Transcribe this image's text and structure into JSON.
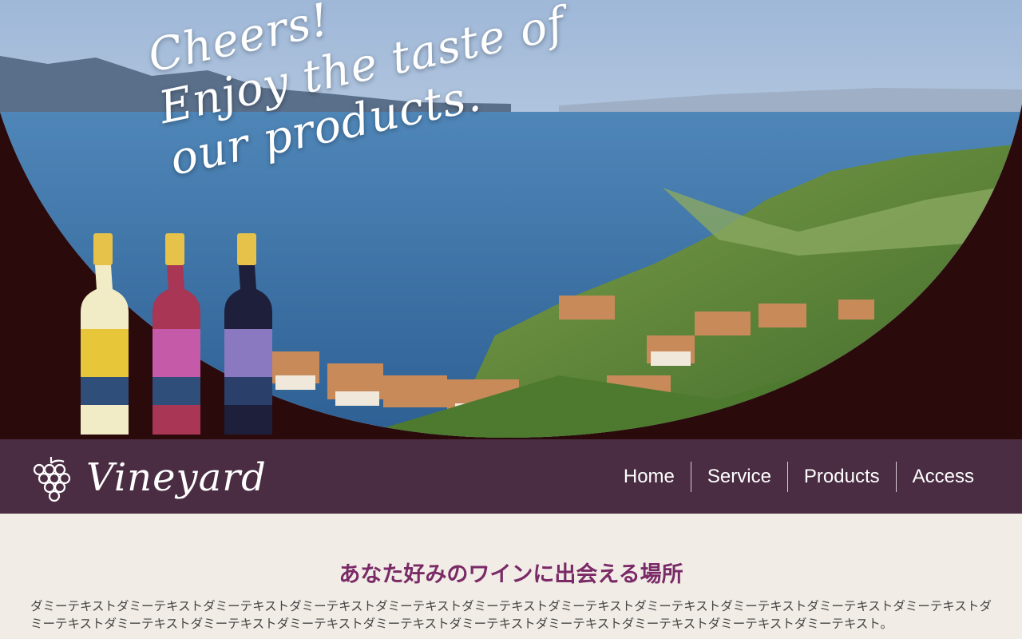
{
  "hero": {
    "tagline_lines": [
      "Cheers!",
      "Enjoy the taste of",
      "our products."
    ]
  },
  "header": {
    "logo_text": "Vineyard",
    "nav": [
      {
        "label": "Home"
      },
      {
        "label": "Service"
      },
      {
        "label": "Products"
      },
      {
        "label": "Access"
      }
    ]
  },
  "main": {
    "headline": "あなた好みのワインに出会える場所",
    "body": "ダミーテキストダミーテキストダミーテキストダミーテキストダミーテキストダミーテキストダミーテキストダミーテキストダミーテキストダミーテキストダミーテキストダミーテキストダミーテキストダミーテキストダミーテキストダミーテキストダミーテキストダミーテキストダミーテキストダミーテキストダミーテキスト。"
  },
  "colors": {
    "hero_frame": "#2b0a0c",
    "navbar": "#4a2d42",
    "headline": "#7a2a66",
    "page_bg": "#f1ece6"
  },
  "icons": {
    "logo": "grape-icon"
  }
}
